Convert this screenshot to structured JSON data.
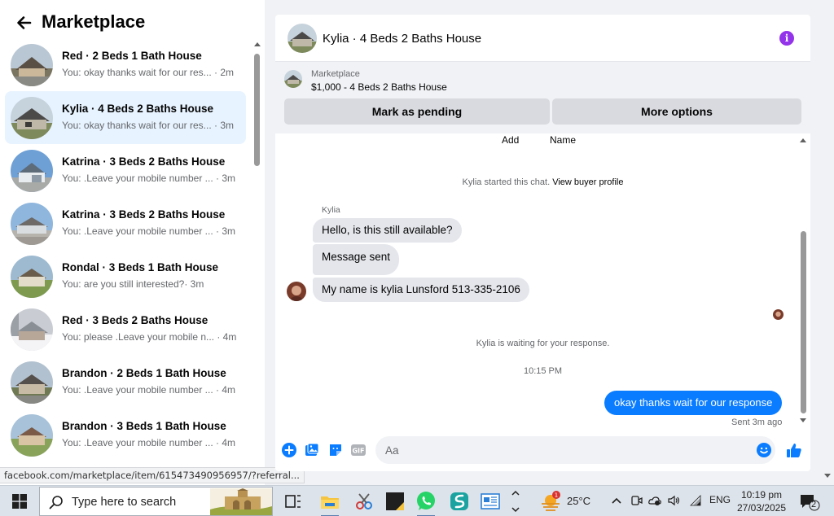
{
  "sidebar": {
    "title": "Marketplace",
    "conversations": [
      {
        "title": "Red · 2 Beds 1 Bath House",
        "preview": "You: okay thanks wait for our res... · 2m",
        "scene": "house-tan"
      },
      {
        "title": "Kylia · 4 Beds 2 Baths House",
        "preview": "You: okay thanks wait for our res... · 3m",
        "scene": "house-gray"
      },
      {
        "title": "Katrina · 3 Beds 2 Baths House",
        "preview": "You: .Leave your mobile number ... · 3m",
        "scene": "house-white"
      },
      {
        "title": "Katrina · 3 Beds 2 Baths House",
        "preview": "You: .Leave your mobile number ... · 3m",
        "scene": "house-blue"
      },
      {
        "title": "Rondal · 3 Beds 1 Bath House",
        "preview": "You: are you still interested?· 3m",
        "scene": "house-field"
      },
      {
        "title": "Red · 3 Beds 2 Baths House",
        "preview": "You: please .Leave your mobile n... · 4m",
        "scene": "house-snow"
      },
      {
        "title": "Brandon · 2 Beds 1 Bath House",
        "preview": "You: .Leave your mobile number ... · 4m",
        "scene": "house-tan"
      },
      {
        "title": "Brandon · 3 Beds 1 Bath House",
        "preview": "You: .Leave your mobile number ... · 4m",
        "scene": "house-field"
      }
    ]
  },
  "status_url": "facebook.com/marketplace/item/615473490956957/?referral...",
  "chat": {
    "title": "Kylia · 4 Beds 2 Baths House",
    "listing": {
      "label": "Marketplace",
      "price_title": "$1,000 - 4 Beds 2 Baths House",
      "mark_pending": "Mark as pending",
      "more_options": "More options"
    },
    "col_add": "Add",
    "col_name": "Name",
    "started_text": "Kylia started this chat.",
    "view_profile": "View buyer profile",
    "sender_name": "Kylia",
    "messages": [
      "Hello, is this still available?",
      "Message sent",
      "My name is kylia Lunsford 513-335-2106"
    ],
    "waiting_text": "Kylia is waiting for your response.",
    "time_divider": "10:15 PM",
    "own_message": "okay thanks wait for our response",
    "sent_status": "Sent 3m ago",
    "input_placeholder": "Aa"
  },
  "taskbar": {
    "search_placeholder": "Type here to search",
    "weather_temp": "25°C",
    "weather_badge": "1",
    "language": "ENG",
    "time": "10:19 pm",
    "date": "27/03/2025",
    "notification_count": "2"
  },
  "colors": {
    "accent_blue": "#0a7cff",
    "active_row": "#e7f3ff",
    "info_purple": "#9333ea"
  }
}
